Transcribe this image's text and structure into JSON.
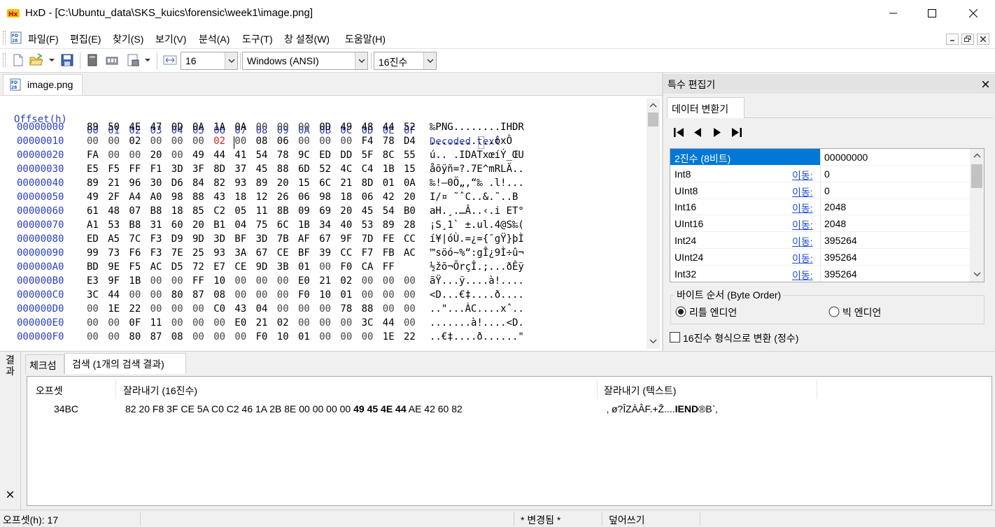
{
  "window": {
    "title": "HxD - [C:\\Ubuntu_data\\SKS_kuics\\forensic\\week1\\image.png]"
  },
  "menu": [
    "파일(F)",
    "편집(E)",
    "찾기(S)",
    "보기(V)",
    "분석(A)",
    "도구(T)",
    "창 설정(W)",
    "도움말(H)"
  ],
  "toolbar": {
    "bytes_per_row": "16",
    "charset": "Windows (ANSI)",
    "offset_base": "16진수"
  },
  "document": {
    "tab": "image.png",
    "header": {
      "offset": "Offset(h)",
      "columns": [
        "00",
        "01",
        "02",
        "03",
        "04",
        "05",
        "06",
        "07",
        "08",
        "09",
        "0A",
        "0B",
        "0C",
        "0D",
        "0E",
        "0F"
      ],
      "decoded": "Decoded text"
    },
    "rows": [
      {
        "offset": "00000000",
        "hex": [
          "89",
          "50",
          "4E",
          "47",
          "0D",
          "0A",
          "1A",
          "0A",
          "00",
          "00",
          "00",
          "0D",
          "49",
          "48",
          "44",
          "52"
        ],
        "text": "‰PNG........IHDR"
      },
      {
        "offset": "00000010",
        "hex": [
          "00",
          "00",
          "02",
          "00",
          "00",
          "00",
          "02",
          "00",
          "08",
          "06",
          "00",
          "00",
          "00",
          "F4",
          "78",
          "D4"
        ],
        "text": "...........ôxÔ"
      },
      {
        "offset": "00000020",
        "hex": [
          "FA",
          "00",
          "00",
          "20",
          "00",
          "49",
          "44",
          "41",
          "54",
          "78",
          "9C",
          "ED",
          "DD",
          "5F",
          "8C",
          "55"
        ],
        "text": "ú.. .IDATxœíÝ_ŒU"
      },
      {
        "offset": "00000030",
        "hex": [
          "E5",
          "F5",
          "FF",
          "F1",
          "3D",
          "3F",
          "8D",
          "37",
          "45",
          "88",
          "6D",
          "52",
          "4C",
          "C4",
          "1B",
          "15"
        ],
        "text": "åõÿñ=?.7E^mRLÄ.."
      },
      {
        "offset": "00000040",
        "hex": [
          "89",
          "21",
          "96",
          "30",
          "D6",
          "84",
          "82",
          "93",
          "89",
          "20",
          "15",
          "6C",
          "21",
          "8D",
          "01",
          "0A"
        ],
        "text": "‰!–0Ö„‚“‰ .l!..."
      },
      {
        "offset": "00000050",
        "hex": [
          "49",
          "2F",
          "A4",
          "A0",
          "98",
          "88",
          "43",
          "18",
          "12",
          "26",
          "06",
          "98",
          "18",
          "06",
          "42",
          "20"
        ],
        "text": "I/¤ ˜ˆC..&.˜..B "
      },
      {
        "offset": "00000060",
        "hex": [
          "61",
          "48",
          "07",
          "B8",
          "18",
          "85",
          "C2",
          "05",
          "11",
          "8B",
          "09",
          "69",
          "20",
          "45",
          "54",
          "B0"
        ],
        "text": "aH.¸.…Â..‹.i ET°"
      },
      {
        "offset": "00000070",
        "hex": [
          "A1",
          "53",
          "B8",
          "31",
          "60",
          "20",
          "B1",
          "04",
          "75",
          "6C",
          "1B",
          "34",
          "40",
          "53",
          "89",
          "28"
        ],
        "text": "¡S¸1` ±.ul.4@S‰("
      },
      {
        "offset": "00000080",
        "hex": [
          "ED",
          "A5",
          "7C",
          "F3",
          "D9",
          "9D",
          "3D",
          "BF",
          "3D",
          "7B",
          "AF",
          "67",
          "9F",
          "7D",
          "FE",
          "CC"
        ],
        "text": "í¥|óÙ.=¿={¯gŸ}þÌ"
      },
      {
        "offset": "00000090",
        "hex": [
          "99",
          "73",
          "F6",
          "F3",
          "7E",
          "25",
          "93",
          "3A",
          "67",
          "CE",
          "BF",
          "39",
          "CC",
          "F7",
          "FB",
          "AC"
        ],
        "text": "™söó~%“:gÎ¿9Ì÷û¬"
      },
      {
        "offset": "000000A0",
        "hex": [
          "BD",
          "9E",
          "F5",
          "AC",
          "D5",
          "72",
          "E7",
          "CE",
          "9D",
          "3B",
          "01",
          "00",
          "F0",
          "CA",
          "FF"
        ],
        "text": "½žõ¬ÕrçÎ.;...ðÊÿ"
      },
      {
        "offset": "000000B0",
        "hex": [
          "E3",
          "9F",
          "1B",
          "00",
          "00",
          "FF",
          "10",
          "00",
          "00",
          "00",
          "E0",
          "21",
          "02",
          "00",
          "00",
          "00"
        ],
        "text": "ãŸ...ÿ....à!...."
      },
      {
        "offset": "000000C0",
        "hex": [
          "3C",
          "44",
          "00",
          "00",
          "80",
          "87",
          "08",
          "00",
          "00",
          "00",
          "F0",
          "10",
          "01",
          "00",
          "00",
          "00"
        ],
        "text": "<D...€‡....ð...."
      },
      {
        "offset": "000000D0",
        "hex": [
          "00",
          "1E",
          "22",
          "00",
          "00",
          "00",
          "C0",
          "43",
          "04",
          "00",
          "00",
          "00",
          "78",
          "88",
          "00",
          "00"
        ],
        "text": "..\"...ÀC....xˆ.."
      },
      {
        "offset": "000000E0",
        "hex": [
          "00",
          "00",
          "0F",
          "11",
          "00",
          "00",
          "00",
          "E0",
          "21",
          "02",
          "00",
          "00",
          "00",
          "3C",
          "44",
          "00"
        ],
        "text": ".......à!....<D."
      },
      {
        "offset": "000000F0",
        "hex": [
          "00",
          "00",
          "80",
          "87",
          "08",
          "00",
          "00",
          "00",
          "F0",
          "10",
          "01",
          "00",
          "00",
          "00",
          "1E",
          "22"
        ],
        "text": "..€‡....ð......\""
      }
    ]
  },
  "special_editor": {
    "title": "특수 편집기",
    "tab": "데이터 변환기",
    "rows": [
      {
        "name": "2진수 (8비트)",
        "link": "",
        "value": "00000000",
        "selected": true
      },
      {
        "name": "Int8",
        "link": "이동:",
        "value": "0"
      },
      {
        "name": "UInt8",
        "link": "이동:",
        "value": "0"
      },
      {
        "name": "Int16",
        "link": "이동:",
        "value": "2048"
      },
      {
        "name": "UInt16",
        "link": "이동:",
        "value": "2048"
      },
      {
        "name": "Int24",
        "link": "이동:",
        "value": "395264"
      },
      {
        "name": "UInt24",
        "link": "이동:",
        "value": "395264"
      },
      {
        "name": "Int32",
        "link": "이동:",
        "value": "395264"
      }
    ],
    "byte_order_label": "바이트 순서 (Byte Order)",
    "little_endian": "리틀 엔디언",
    "big_endian": "빅 엔디언",
    "hex_checkbox": "16진수 형식으로 변환 (정수)"
  },
  "results": {
    "side_label": "결과",
    "tabs": [
      "체크섬",
      "검색 (1개의 검색 결과)"
    ],
    "columns": [
      "오프셋",
      "잘라내기 (16진수)",
      "잘라내기 (텍스트)"
    ],
    "row": {
      "offset": "34BC",
      "hex_pre": "82 20 F8 3F CE 5A C0 C2 46 1A 2B 8E 00 00 00 00 ",
      "hex_bold": "49 45 4E 44",
      "hex_post": " AE 42 60 82",
      "text_pre": "‚ ø?ÎZÀÂF.+Ž....",
      "text_bold": "IEND",
      "text_post": "®B`‚"
    }
  },
  "status": {
    "offset": "오프셋(h): 17",
    "modified": "* 변경됨 *",
    "mode": "덮어쓰기"
  }
}
